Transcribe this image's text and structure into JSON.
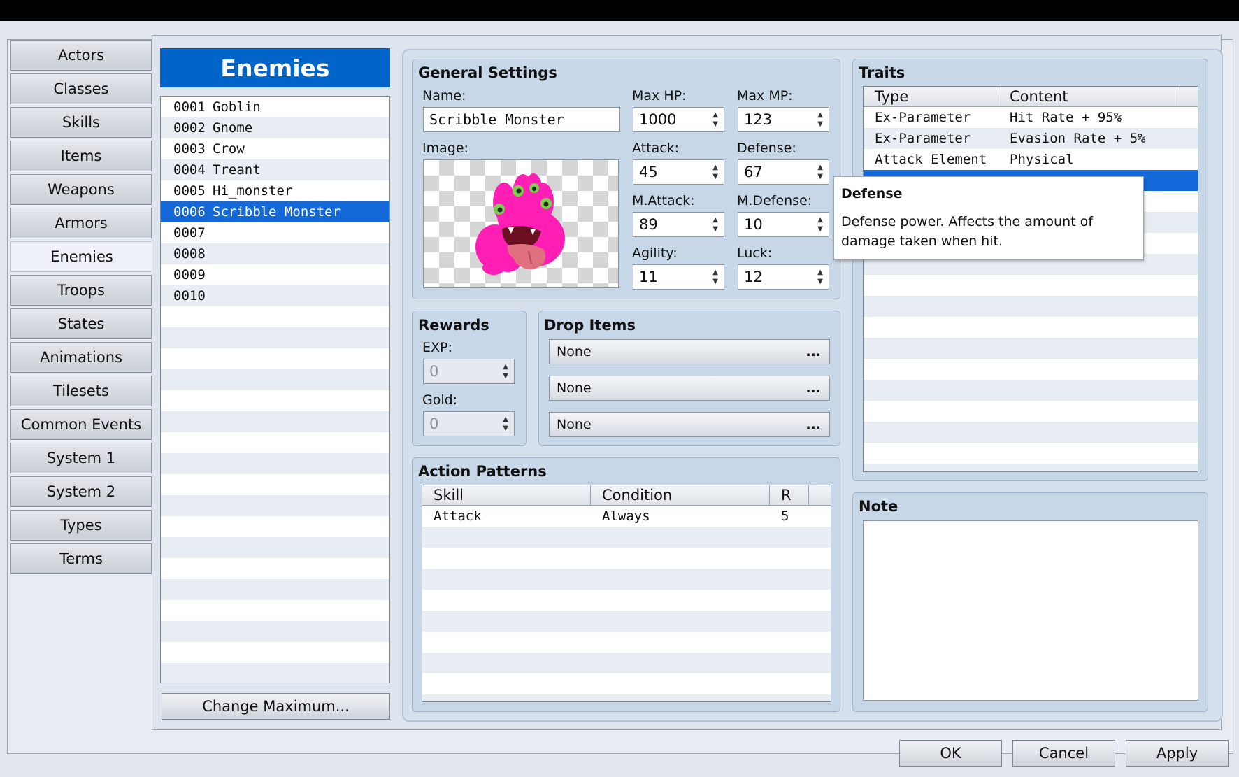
{
  "tabs": [
    "Actors",
    "Classes",
    "Skills",
    "Items",
    "Weapons",
    "Armors",
    "Enemies",
    "Troops",
    "States",
    "Animations",
    "Tilesets",
    "Common Events",
    "System 1",
    "System 2",
    "Types",
    "Terms"
  ],
  "active_tab": "Enemies",
  "list": {
    "title": "Enemies",
    "items": [
      {
        "id": "0001",
        "name": "Goblin"
      },
      {
        "id": "0002",
        "name": "Gnome"
      },
      {
        "id": "0003",
        "name": "Crow"
      },
      {
        "id": "0004",
        "name": "Treant"
      },
      {
        "id": "0005",
        "name": "Hi_monster"
      },
      {
        "id": "0006",
        "name": "Scribble Monster"
      },
      {
        "id": "0007",
        "name": ""
      },
      {
        "id": "0008",
        "name": ""
      },
      {
        "id": "0009",
        "name": ""
      },
      {
        "id": "0010",
        "name": ""
      }
    ],
    "selected": "0006",
    "change_max_label": "Change Maximum..."
  },
  "general": {
    "title": "General Settings",
    "name_label": "Name:",
    "name_value": "Scribble Monster",
    "image_label": "Image:",
    "maxhp_label": "Max HP:",
    "maxhp": "1000",
    "maxmp_label": "Max MP:",
    "maxmp": "123",
    "attack_label": "Attack:",
    "attack": "45",
    "defense_label": "Defense:",
    "defense": "67",
    "mattack_label": "M.Attack:",
    "mattack": "89",
    "mdefense_label": "M.Defense:",
    "mdefense": "10",
    "agility_label": "Agility:",
    "agility": "11",
    "luck_label": "Luck:",
    "luck": "12"
  },
  "rewards": {
    "title": "Rewards",
    "exp_label": "EXP:",
    "exp": "0",
    "gold_label": "Gold:",
    "gold": "0"
  },
  "drops": {
    "title": "Drop Items",
    "items": [
      "None",
      "None",
      "None"
    ],
    "dots": "..."
  },
  "actions": {
    "title": "Action Patterns",
    "headers": [
      "Skill",
      "Condition",
      "R"
    ],
    "rows": [
      {
        "skill": "Attack",
        "condition": "Always",
        "r": "5"
      }
    ]
  },
  "traits": {
    "title": "Traits",
    "headers": [
      "Type",
      "Content"
    ],
    "rows": [
      {
        "type": "Ex-Parameter",
        "content": "Hit Rate + 95%"
      },
      {
        "type": "Ex-Parameter",
        "content": "Evasion Rate + 5%"
      },
      {
        "type": "Attack Element",
        "content": "Physical"
      }
    ]
  },
  "note": {
    "title": "Note",
    "value": ""
  },
  "tooltip": {
    "title": "Defense",
    "text": "Defense power. Affects the amount of damage taken when hit."
  },
  "buttons": {
    "ok": "OK",
    "cancel": "Cancel",
    "apply": "Apply"
  },
  "colors": {
    "selection": "#1468d8",
    "header_blue": "#0064c8",
    "monster_pink": "#ff1fb4"
  }
}
